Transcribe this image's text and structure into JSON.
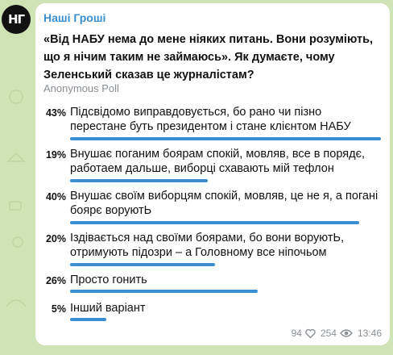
{
  "channel": {
    "name": "Наші Гроші",
    "avatar_text": "НГ"
  },
  "poll": {
    "question": "«Від НАБУ нема до мене ніяких питань. Вони розуміють, що я нічим таким не займаюсь». Як думаєте, чому Зеленський сказав це журналістам?",
    "type": "Anonymous Poll",
    "options": [
      {
        "percent": "43%",
        "fraction": 0.43,
        "text": "Підсвідомо виправдовується, бо рано чи пізно перестане буть президентом і стане клієнтом НАБУ"
      },
      {
        "percent": "19%",
        "fraction": 0.19,
        "text": "Внушає поганим боярам спокій, мовляв, все в порядє, работаем дальше, виборці схавають мій тефлон"
      },
      {
        "percent": "40%",
        "fraction": 0.4,
        "text": "Внушає своїм виборцям спокій, мовляв, це не я, а погані боярє воруютЬ"
      },
      {
        "percent": "20%",
        "fraction": 0.2,
        "text": "Іздівається над своїми боярами, бо вони воруютЬ, отримують підозри – а Головному все ніпочьом"
      },
      {
        "percent": "26%",
        "fraction": 0.26,
        "text": "Просто гонить"
      },
      {
        "percent": "5%",
        "fraction": 0.05,
        "text": "Інший варіант"
      }
    ]
  },
  "footer": {
    "reactions": "94",
    "views": "254",
    "time": "13:46"
  },
  "colors": {
    "accent": "#3b8fd1",
    "background": "#cfe3b5"
  }
}
